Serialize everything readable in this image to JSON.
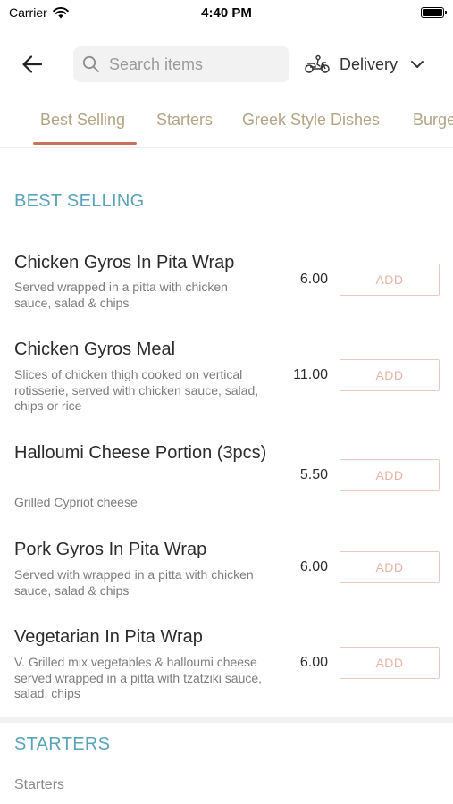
{
  "status_bar": {
    "carrier": "Carrier",
    "time": "4:40 PM"
  },
  "header": {
    "search": {
      "placeholder": "Search items",
      "value": ""
    },
    "delivery_label": "Delivery"
  },
  "tabs": [
    {
      "label": "Best Selling",
      "active": true
    },
    {
      "label": "Starters",
      "active": false
    },
    {
      "label": "Greek Style Dishes",
      "active": false
    },
    {
      "label": "Burge",
      "active": false
    }
  ],
  "sections": {
    "best_selling": {
      "title": "BEST SELLING",
      "items": [
        {
          "name": "Chicken Gyros In Pita Wrap",
          "description": "Served wrapped in a pitta with chicken sauce, salad & chips",
          "price": "6.00",
          "button": "ADD"
        },
        {
          "name": "Chicken Gyros Meal",
          "description": "Slices of chicken thigh cooked on vertical rotisserie, served with chicken sauce, salad, chips or rice",
          "price": "11.00",
          "button": "ADD"
        },
        {
          "name": "Halloumi Cheese Portion (3pcs)",
          "description": "Grilled Cypriot cheese",
          "price": "5.50",
          "button": "ADD"
        },
        {
          "name": "Pork Gyros In Pita Wrap",
          "description": "Served with wrapped in a pitta with chicken sauce, salad & chips",
          "price": "6.00",
          "button": "ADD"
        },
        {
          "name": "Vegetarian In Pita Wrap",
          "description": "V. Grilled mix vegetables & halloumi cheese served wrapped in a pitta with tzatziki sauce, salad, chips",
          "price": "6.00",
          "button": "ADD"
        }
      ]
    },
    "starters": {
      "title": "STARTERS",
      "subtitle": "Starters"
    }
  },
  "colors": {
    "accent_teal": "#5aa3b9",
    "tab_text": "#b3a484",
    "tab_underline": "#c9735c",
    "add_button_border": "#ecc9bf"
  },
  "icons": {
    "back": "arrow-left-icon",
    "search": "search-icon",
    "delivery": "scooter-icon",
    "dropdown": "chevron-down-icon",
    "wifi": "wifi-icon",
    "battery": "battery-icon"
  }
}
